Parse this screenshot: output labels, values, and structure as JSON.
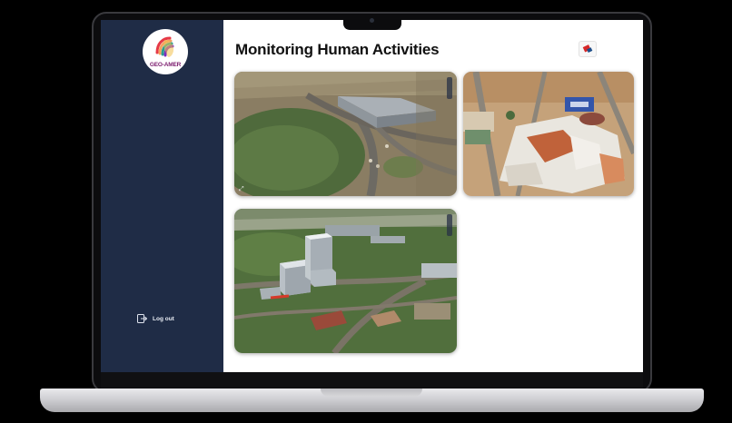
{
  "device": {
    "type": "laptop"
  },
  "sidebar": {
    "logo": {
      "text": "GEO-AMER"
    },
    "logout": {
      "label": "Log out",
      "icon": "logout-icon"
    }
  },
  "header": {
    "title": "Monitoring Human Activities",
    "language_icon": "flag-icon"
  },
  "cards": [
    {
      "scene": "3d-map-interchange-warehouse"
    },
    {
      "scene": "3d-map-market-rooftops"
    },
    {
      "scene": "3d-map-city-towers"
    }
  ],
  "colors": {
    "sidebar": "#1f2c46",
    "background": "#ffffff",
    "title": "#111111"
  }
}
